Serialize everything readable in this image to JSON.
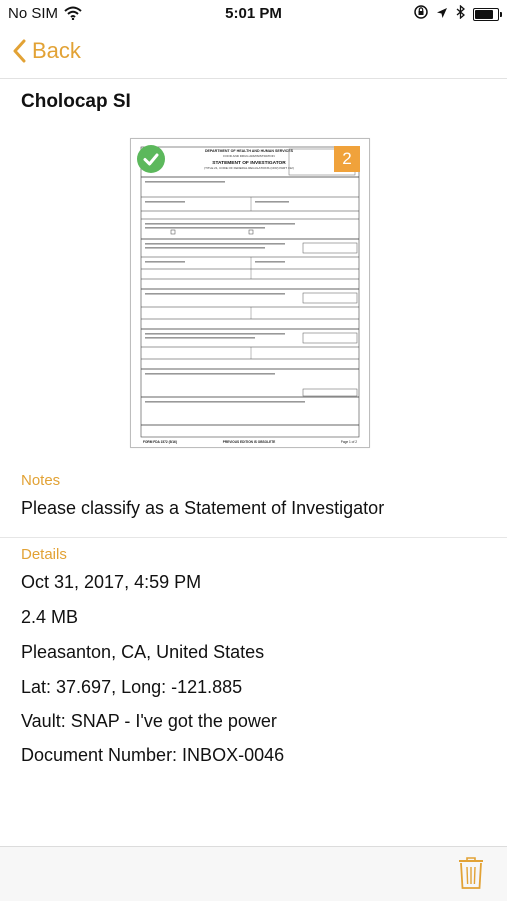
{
  "status": {
    "carrier": "No SIM",
    "time": "5:01 PM",
    "battery_level": 0.9
  },
  "nav": {
    "back_label": "Back"
  },
  "document": {
    "title": "Cholocap SI",
    "page_count": "2",
    "thumbnail": {
      "header": "DEPARTMENT OF HEALTH AND HUMAN SERVICES",
      "subheader": "FOOD AND DRUG ADMINISTRATION",
      "heading": "STATEMENT OF INVESTIGATOR",
      "subheading": "(TITLE 21, CODE OF FEDERAL REGULATIONS (CFR) PART 312)",
      "footer_left": "FORM FDA 1572 (5/16)",
      "footer_mid": "PREVIOUS EDITION IS OBSOLETE",
      "footer_right": "Page 1 of 2"
    }
  },
  "notes": {
    "label": "Notes",
    "text": "Please classify as a Statement of Investigator"
  },
  "details": {
    "label": "Details",
    "date": "Oct 31, 2017, 4:59 PM",
    "size": "2.4 MB",
    "location": "Pleasanton, CA, United States",
    "coordinates": "Lat: 37.697, Long: -121.885",
    "vault": "Vault: SNAP - I've got the power",
    "document_number": "Document Number: INBOX-0046"
  },
  "colors": {
    "accent": "#e2a235",
    "badge_green": "#5cb85c",
    "badge_orange": "#f0a23b"
  },
  "icons": {
    "wifi": "wifi-icon",
    "lock_rotation": "orientation-lock-icon",
    "location": "location-arrow-icon",
    "bluetooth": "bluetooth-icon",
    "battery": "battery-icon",
    "back": "chevron-left-icon",
    "check": "check-icon",
    "trash": "trash-icon"
  }
}
